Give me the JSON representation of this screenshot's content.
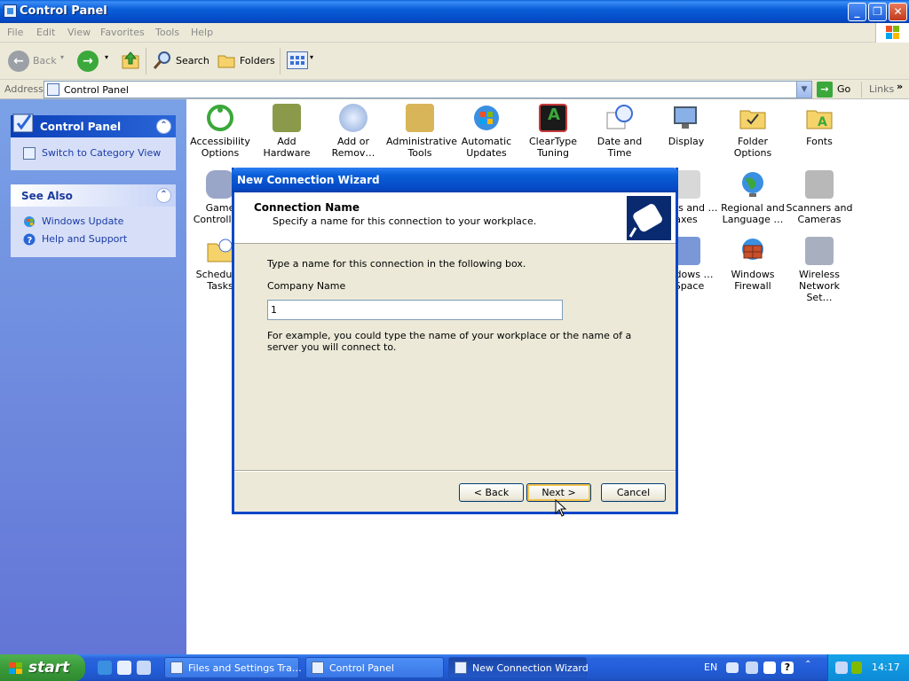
{
  "window": {
    "title": "Control Panel"
  },
  "menu": [
    "File",
    "Edit",
    "View",
    "Favorites",
    "Tools",
    "Help"
  ],
  "toolbar": {
    "back": "Back",
    "search": "Search",
    "folders": "Folders"
  },
  "address": {
    "label": "Address",
    "value": "Control Panel",
    "go": "Go",
    "links": "Links"
  },
  "left_panel": {
    "control_panel": {
      "title": "Control Panel",
      "link": "Switch to Category View"
    },
    "see_also": {
      "title": "See Also",
      "links": [
        "Windows Update",
        "Help and Support"
      ]
    }
  },
  "items": [
    "Accessibility Options",
    "Add Hardware",
    "Add or Remov…",
    "Administrative Tools",
    "Automatic Updates",
    "ClearType Tuning",
    "Date and Time",
    "Display",
    "Folder Options",
    "Fonts",
    "Game Controlle…",
    "…ters and …axes",
    "Regional and Language …",
    "Scanners and Cameras",
    "Schedul… Tasks",
    "…ndows …dSpace",
    "Windows Firewall",
    "Wireless Network Set…"
  ],
  "dialog": {
    "title": "New Connection Wizard",
    "header_title": "Connection Name",
    "header_subtitle": "Specify a name for this connection to your workplace.",
    "instruction": "Type a name for this connection in the following box.",
    "field_label": "Company Name",
    "field_value": "1",
    "example": "For example, you could type the name of your workplace or the name of a server you will connect to.",
    "back": "< Back",
    "next": "Next >",
    "cancel": "Cancel"
  },
  "taskbar": {
    "start": "start",
    "tasks": [
      "Files and Settings Tra…",
      "Control Panel",
      "New Connection Wizard"
    ],
    "language": "EN",
    "clock": "14:17"
  },
  "colors": {
    "titlebar": "#0a5fd8",
    "taskbar": "#245edb",
    "start": "#3a9b3a",
    "sidebar": "#6375d6"
  }
}
